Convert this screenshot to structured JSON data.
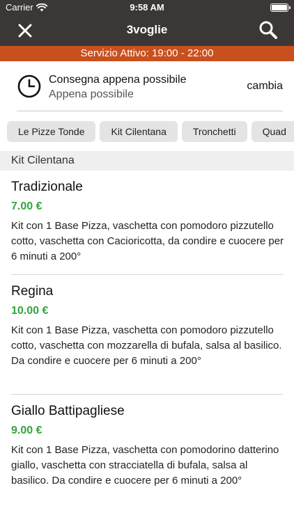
{
  "status_bar": {
    "carrier": "Carrier",
    "time": "9:58 AM"
  },
  "header": {
    "title": "3voglie",
    "close_icon": "close-icon",
    "search_icon": "search-icon"
  },
  "service": {
    "text": "Servizio Attivo: 19:00 - 22:00"
  },
  "delivery": {
    "mode": "Consegna appena possibile",
    "sub": "Appena possibile",
    "change_label": "cambia"
  },
  "categories": [
    "Le Pizze Tonde",
    "Kit Cilentana",
    "Tronchetti",
    "Quad"
  ],
  "section": {
    "title": "Kit Cilentana"
  },
  "products": [
    {
      "name": "Tradizionale",
      "price": "7.00 €",
      "desc": "Kit con 1 Base Pizza, vaschetta con pomodoro pizzutello cotto, vaschetta con Cacioricotta, da condire e cuocere per 6 minuti a 200°"
    },
    {
      "name": "Regina",
      "price": "10.00 €",
      "desc": "Kit con 1 Base Pizza, vaschetta con pomodoro pizzutello cotto, vaschetta con mozzarella di bufala, salsa al basilico. Da condire e cuocere per 6 minuti a 200°"
    },
    {
      "name": "Giallo Battipagliese",
      "price": "9.00 €",
      "desc": "Kit con 1 Base Pizza, vaschetta con pomodorino datterino giallo, vaschetta con stracciatella di bufala, salsa al basilico. Da condire e cuocere per 6 minuti a 200°"
    }
  ],
  "colors": {
    "header_bg": "#3c3737",
    "service_bg": "#c8501e",
    "price": "#31a63c",
    "chip_bg": "#e4e4e4"
  }
}
